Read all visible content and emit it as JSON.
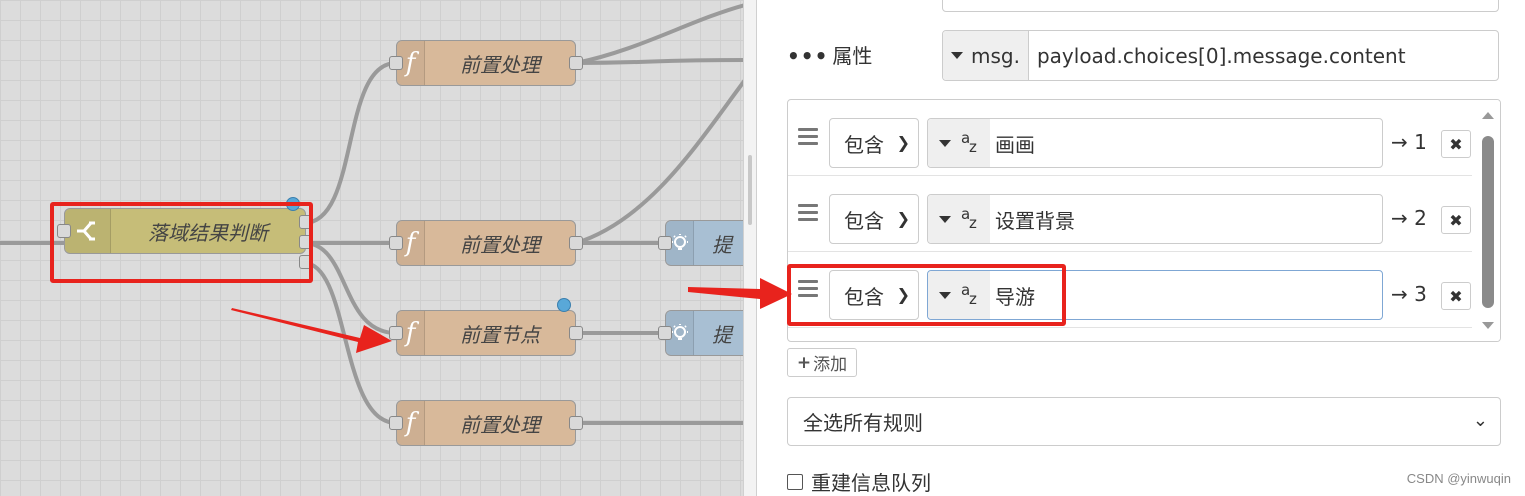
{
  "canvas": {
    "switch_node": {
      "label": "落域结果判断"
    },
    "function_nodes": [
      {
        "label": "前置处理"
      },
      {
        "label": "前置处理"
      },
      {
        "label": "前置节点"
      },
      {
        "label": "前置处理"
      }
    ],
    "light_nodes": [
      {
        "label": "提"
      },
      {
        "label": "提"
      }
    ],
    "highlight_color": "#e8231d"
  },
  "panel": {
    "property": {
      "label": "属性",
      "type": "msg.",
      "value": "payload.choices[0].message.content"
    },
    "rules": [
      {
        "operator": "包含",
        "value": "画画",
        "output": "→ 1"
      },
      {
        "operator": "包含",
        "value": "设置背景",
        "output": "→ 2"
      },
      {
        "operator": "包含",
        "value": "导游",
        "output": "→ 3"
      }
    ],
    "add_button": "添加",
    "mode_select": "全选所有规则",
    "checkbox_label": "重建信息队列"
  },
  "watermark": "CSDN @yinwuqin"
}
